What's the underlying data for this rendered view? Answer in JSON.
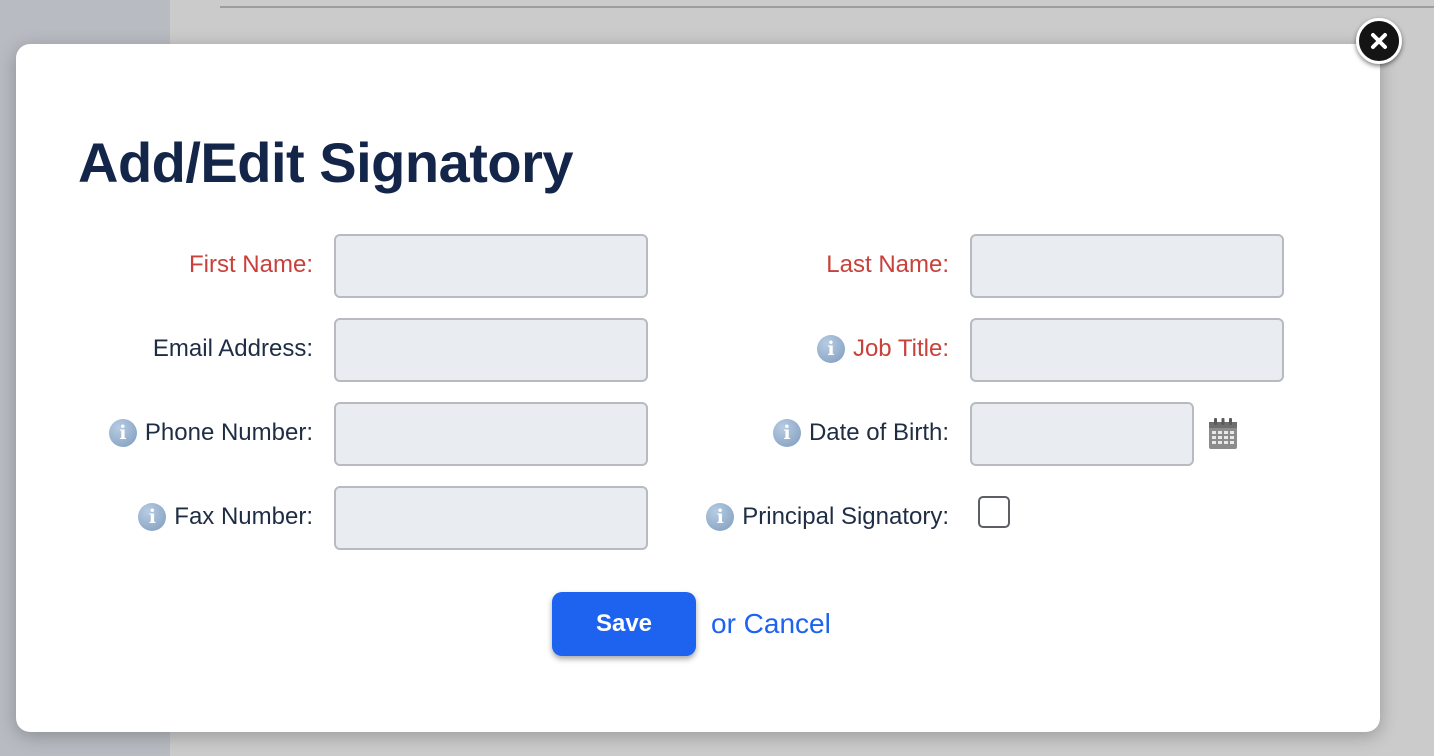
{
  "dialog": {
    "title": "Add/Edit Signatory",
    "close_icon": "close-icon",
    "fields": {
      "first_name": {
        "label": "First Name:",
        "value": "",
        "required": true
      },
      "last_name": {
        "label": "Last Name:",
        "value": "",
        "required": true
      },
      "email": {
        "label": "Email Address:",
        "value": ""
      },
      "job_title": {
        "label": "Job Title:",
        "value": "",
        "required": true,
        "icon": "info-icon"
      },
      "phone": {
        "label": "Phone Number:",
        "value": "",
        "icon": "info-icon"
      },
      "dob": {
        "label": "Date of Birth:",
        "value": "",
        "icon": "info-icon",
        "picker_icon": "calendar-icon"
      },
      "fax": {
        "label": "Fax Number:",
        "value": "",
        "icon": "info-icon"
      },
      "principal": {
        "label": "Principal Signatory:",
        "checked": false,
        "icon": "info-icon"
      }
    },
    "save_label": "Save",
    "cancel_label": "or Cancel"
  },
  "colors": {
    "required_label": "#c8413a",
    "title": "#13264a",
    "primary": "#1e63f0",
    "field_bg": "#e9ecf0",
    "info_icon": "#8faac8"
  }
}
